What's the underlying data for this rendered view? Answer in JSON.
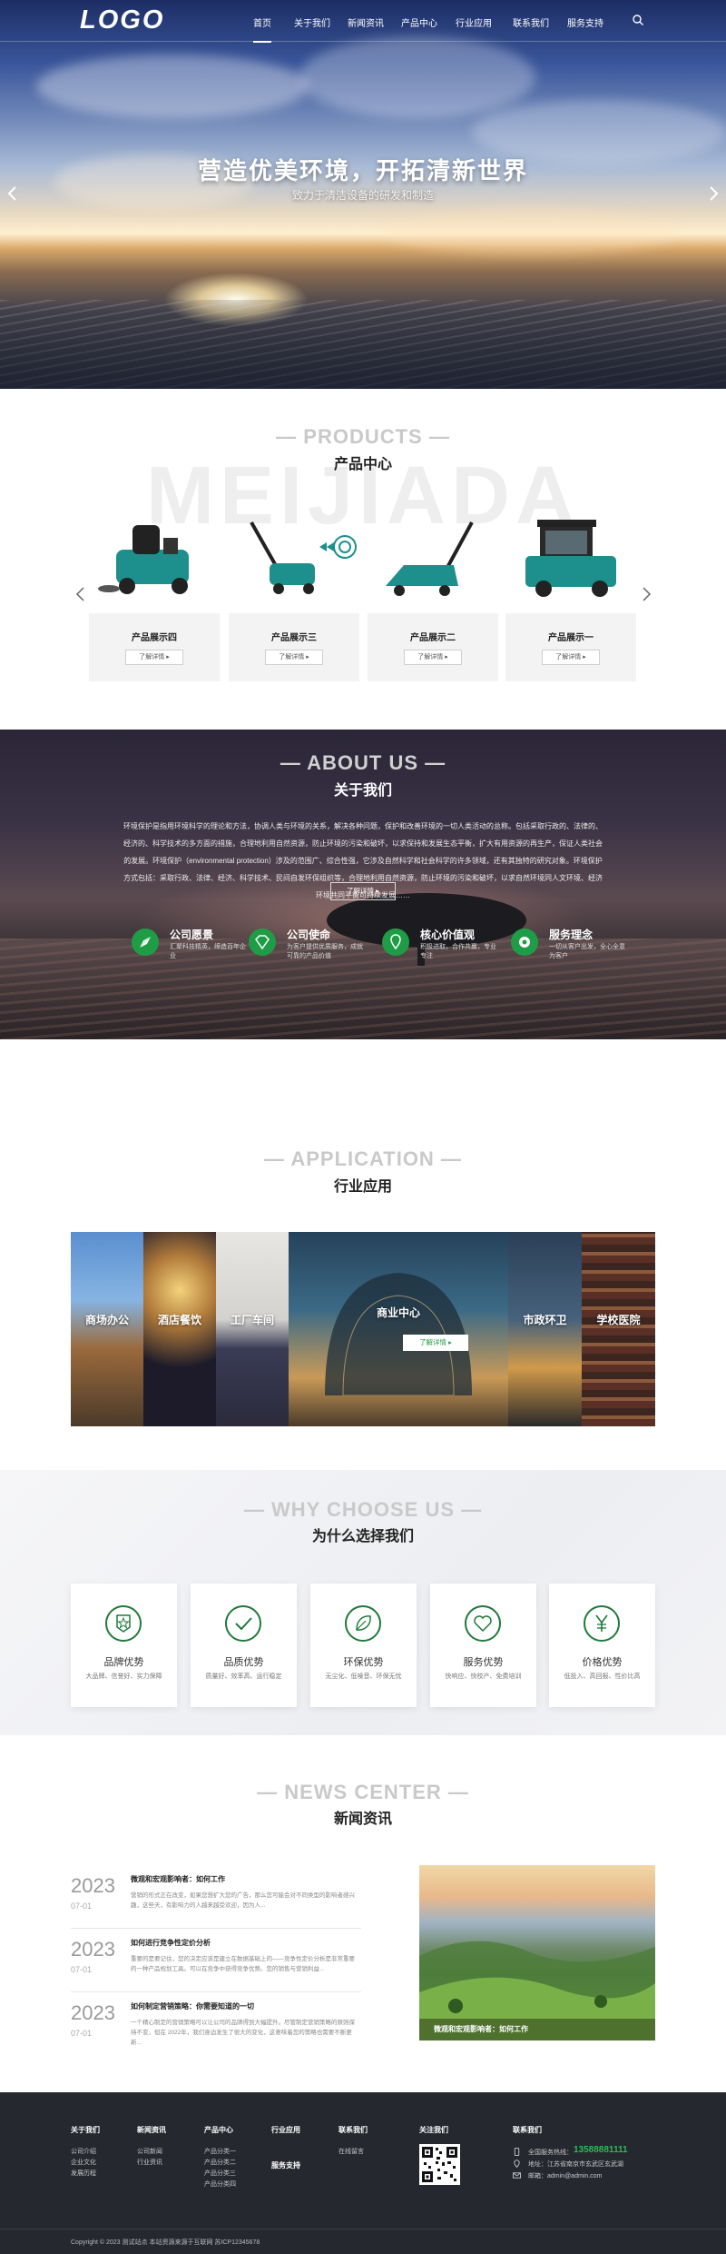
{
  "nav": {
    "logo": "LOGO",
    "items": [
      "首页",
      "关于我们",
      "新闻资讯",
      "产品中心",
      "行业应用",
      "联系我们",
      "服务支持"
    ]
  },
  "hero": {
    "title": "营造优美环境，开拓清新世界",
    "subtitle": "致力于清洁设备的研发和制造"
  },
  "products": {
    "en": "— PRODUCTS —",
    "cn": "产品中心",
    "watermark": "MEIJIADA",
    "items": [
      {
        "name": "产品展示四",
        "button": "了解详情 ▸"
      },
      {
        "name": "产品展示三",
        "button": "了解详情 ▸"
      },
      {
        "name": "产品展示二",
        "button": "了解详情 ▸"
      },
      {
        "name": "产品展示一",
        "button": "了解详情 ▸"
      }
    ]
  },
  "about": {
    "en": "— ABOUT US —",
    "cn": "关于我们",
    "text": "环境保护是指用环境科学的理论和方法，协调人类与环境的关系，解决各种问题，保护和改善环境的一切人类活动的总称。包括采取行政的、法律的、经济的、科学技术的多方面的措施，合理地利用自然资源，防止环境的污染和破坏，以求保持和发展生态平衡，扩大有用资源的再生产，保证人类社会的发展。环境保护（environmental protection）涉及的范围广、综合性强，它涉及自然科学和社会科学的许多领域，还有其独特的研究对象。环境保护方式包括：采取行政、法律、经济、科学技术、民间自发环保组织等，合理地利用自然资源，防止环境的污染和破坏，以求自然环境同人文环境、经济环境共同平衡可持续发展……",
    "more": "了解详情 ▸",
    "items": [
      {
        "title": "公司愿景",
        "desc": "汇聚科技精英，缔造百年企业"
      },
      {
        "title": "公司使命",
        "desc": "为客户提供优质服务，成就可靠的产品价值"
      },
      {
        "title": "核心价值观",
        "desc": "积极进取，合作共赢，专业专注"
      },
      {
        "title": "服务理念",
        "desc": "一切从客户出发，全心全意为客户"
      }
    ]
  },
  "application": {
    "en": "— APPLICATION —",
    "cn": "行业应用",
    "panels": [
      "商场办公",
      "酒店餐饮",
      "工厂车间",
      "商业中心",
      "市政环卫",
      "学校医院"
    ],
    "more": "了解详情 ▸"
  },
  "why": {
    "en": "— WHY CHOOSE US —",
    "cn": "为什么选择我们",
    "items": [
      {
        "title": "品牌优势",
        "desc": "大品牌、信誉好、实力保障",
        "icon": "star-badge-icon"
      },
      {
        "title": "品质优势",
        "desc": "质量好、效率高、运行稳定",
        "icon": "check-icon"
      },
      {
        "title": "环保优势",
        "desc": "无尘化、低噪音、环保无忧",
        "icon": "leaf-icon"
      },
      {
        "title": "服务优势",
        "desc": "快响应、快校产、免费培训",
        "icon": "heart-icon"
      },
      {
        "title": "价格优势",
        "desc": "低投入、高回报、性价比高",
        "icon": "yen-icon"
      }
    ]
  },
  "news": {
    "en": "— NEWS CENTER —",
    "cn": "新闻资讯",
    "items": [
      {
        "year": "2023",
        "md": "07-01",
        "title": "微观和宏观影响者：如何工作",
        "desc": "营销的形式正在改变，如果您想扩大您的广告，那么您可能会对不同类型的影响者感兴趣，这些天，有影响力的人越来越受欢迎，因为人..."
      },
      {
        "year": "2023",
        "md": "07-01",
        "title": "如何进行竞争性定价分析",
        "desc": "重要的是要记住，您的决定应该是建立在数据基础上的——竞争性定价分析是非常重要的一种产品规划工具。可以在竞争中获得竞争优势。您的销售与营销利益..."
      },
      {
        "year": "2023",
        "md": "07-01",
        "title": "如何制定营销策略：你需要知道的一切",
        "desc": "一个精心制定的营销策略可以让公司的品牌得到大幅提升。尽管制定营销策略的原则保持不变，但在 2022年，我们身边发生了很大的变化，这意味着您的策略也需要不断更新..."
      }
    ],
    "featured_caption": "微观和宏观影响者：如何工作"
  },
  "footer": {
    "cols": [
      {
        "title": "关于我们",
        "links": [
          "公司介绍",
          "企业文化",
          "发展历程"
        ]
      },
      {
        "title": "新闻资讯",
        "links": [
          "公司新闻",
          "行业资讯"
        ]
      },
      {
        "title": "产品中心",
        "links": [
          "产品分类一",
          "产品分类二",
          "产品分类三",
          "产品分类四"
        ]
      },
      {
        "title": "行业应用",
        "links": []
      },
      {
        "title": "联系我们",
        "links": [
          "在线留言"
        ]
      },
      {
        "title": "关注我们",
        "links": []
      },
      {
        "title": "联系我们",
        "links": []
      }
    ],
    "service": "服务支持",
    "hotline_label": "全国服务热线：",
    "hotline": "13588881111",
    "address": "地址：江苏省南京市玄武区玄武湖",
    "email": "邮箱：admin@admin.com",
    "copyright": "Copyright © 2023 测试站点 本站资源来源于互联网 苏ICP12345678"
  },
  "colors": {
    "accent": "#1f9c46",
    "footer_bg": "#25282f"
  }
}
